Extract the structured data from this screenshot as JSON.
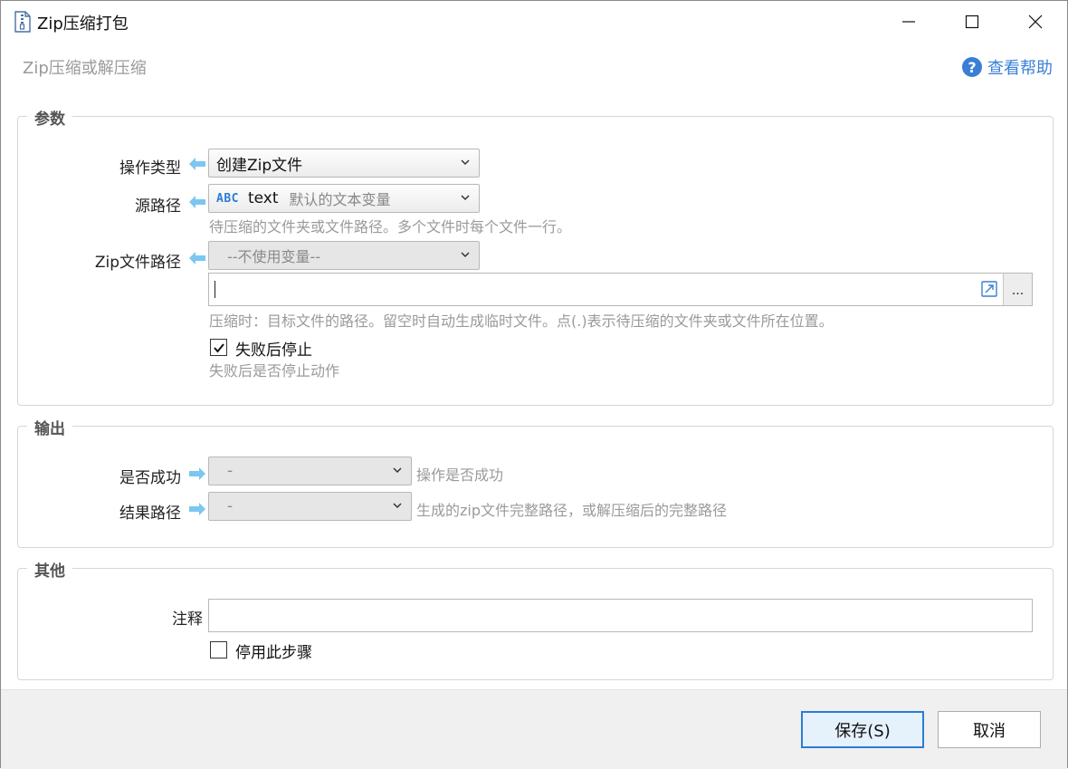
{
  "window": {
    "title": "Zip压缩打包",
    "subtitle": "Zip压缩或解压缩",
    "help_label": "查看帮助"
  },
  "params": {
    "group_title": "参数",
    "operation_label": "操作类型",
    "operation_value": "创建Zip文件",
    "source_label": "源路径",
    "source_var_type": "ABC",
    "source_var_name": "text",
    "source_var_desc": "默认的文本变量",
    "source_hint": "待压缩的文件夹或文件路径。多个文件时每个文件一行。",
    "zip_label": "Zip文件路径",
    "zip_var_value": "--不使用变量--",
    "zip_input_value": "",
    "zip_browse_label": "...",
    "zip_hint": "压缩时：目标文件的路径。留空时自动生成临时文件。点(.)表示待压缩的文件夹或文件所在位置。",
    "stop_on_fail_label": "失败后停止",
    "stop_on_fail_checked": true,
    "stop_on_fail_hint": "失败后是否停止动作"
  },
  "output": {
    "group_title": "输出",
    "success_label": "是否成功",
    "success_value": "-",
    "success_hint": "操作是否成功",
    "result_label": "结果路径",
    "result_value": "-",
    "result_hint": "生成的zip文件完整路径，或解压缩后的完整路径"
  },
  "other": {
    "group_title": "其他",
    "comment_label": "注释",
    "comment_value": "",
    "disable_label": "停用此步骤",
    "disable_checked": false
  },
  "footer": {
    "save_label": "保存(S)",
    "cancel_label": "取消"
  },
  "colors": {
    "accent": "#2b7cd3",
    "hint_gray": "#9a9a9a",
    "arrow_blue": "#7cc6f0"
  }
}
